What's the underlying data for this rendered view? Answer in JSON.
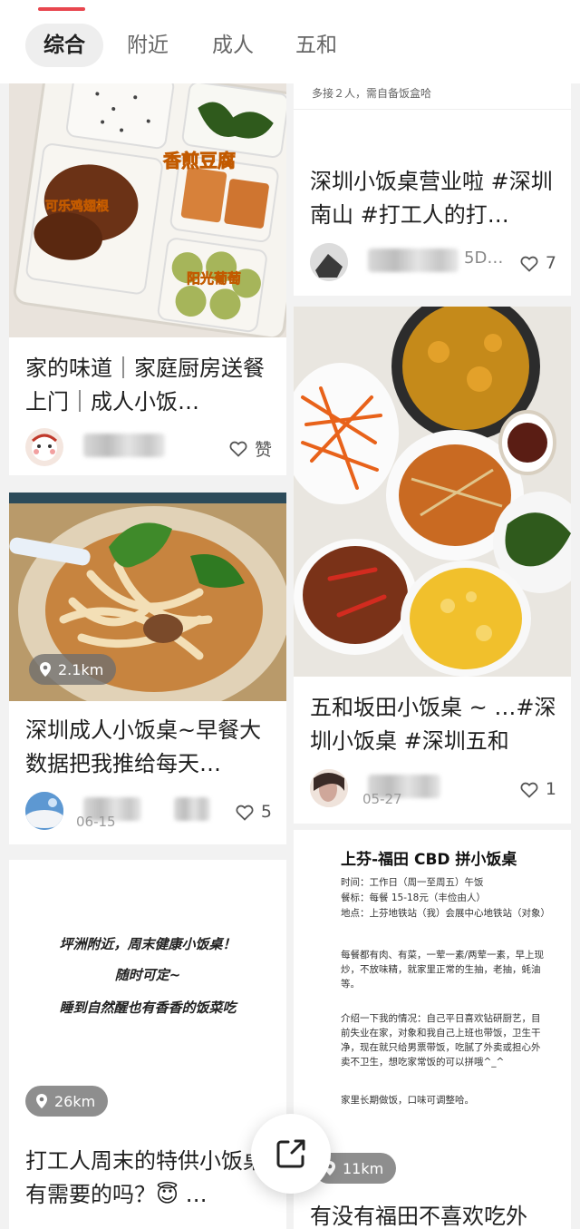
{
  "tabs": {
    "items": [
      {
        "label": "综合",
        "active": true
      },
      {
        "label": "附近",
        "active": false
      },
      {
        "label": "成人",
        "active": false
      },
      {
        "label": "五和",
        "active": false
      }
    ]
  },
  "left": {
    "card1": {
      "photo_labels": {
        "tofu": "香煎豆腐",
        "wings": "可乐鸡翅根",
        "grapes": "阳光葡萄"
      },
      "title": "家的味道｜家庭厨房送餐上门｜成人小饭…",
      "like_label": "赞"
    },
    "card2": {
      "distance": "2.1km",
      "title": "深圳成人小饭桌~早餐大数据把我推给每天…",
      "date": "06-15",
      "likes": "5"
    },
    "card3": {
      "poster": {
        "line1": "坪洲附近，周末健康小饭桌！",
        "line2": "随时可定~",
        "line3": "睡到自然醒也有香香的饭菜吃"
      },
      "distance": "26km",
      "title": "打工人周末的特供小饭桌有需要的吗？😇 …"
    }
  },
  "right": {
    "card1": {
      "top_text": "多接２人，需自备饭盒哈",
      "title": "深圳小饭桌营业啦 #深圳南山 #打工人的打…",
      "author_partial": "5D…",
      "likes": "7"
    },
    "card2": {
      "title": "五和坂田小饭桌 ~ …#深圳小饭桌 #深圳五和",
      "date": "05-27",
      "likes": "1"
    },
    "card3": {
      "notice": {
        "title": "上芬-福田 CBD 拼小饭桌",
        "time": "时间：工作日（周一至周五）午饭",
        "price": "餐标：每餐 15-18元（丰俭由人）",
        "place": "地点：上芬地铁站（我）会展中心地铁站（对象）",
        "menu": "每餐都有肉、有菜，一荤一素/两荤一素，早上现炒，不放味精，就家里正常的生抽，老抽，蚝油等。",
        "intro": "介绍一下我的情况：自己平日喜欢钻研厨艺，目前失业在家，对象和我自己上班也带饭，卫生干净，现在就只给男票带饭，吃腻了外卖或担心外卖不卫生，想吃家常饭的可以拼哦^_^",
        "note": "家里长期做饭，口味可调整哈。"
      },
      "distance": "11km",
      "title": "有没有福田不喜欢吃外"
    }
  },
  "colors": {
    "accent": "#e8464e",
    "background": "#f2f2f2"
  },
  "icons": {
    "share": "share-icon",
    "heart": "heart-icon",
    "location": "location-pin-icon"
  }
}
